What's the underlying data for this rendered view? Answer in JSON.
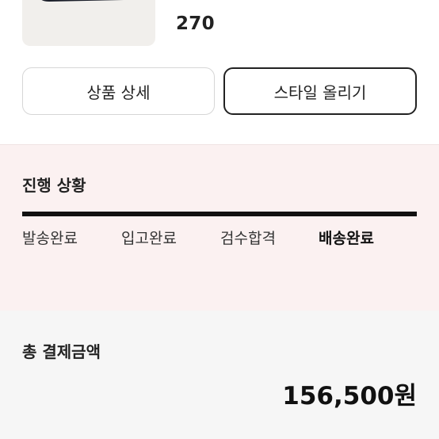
{
  "product": {
    "size": "270"
  },
  "actions": {
    "detail_label": "상품 상세",
    "style_label": "스타일 올리기"
  },
  "progress": {
    "title": "진행 상황",
    "steps": [
      "발송완료",
      "입고완료",
      "검수합격",
      "배송완료"
    ],
    "current_step": "배송완료",
    "completion": 1.0
  },
  "payment": {
    "title": "총 결제금액",
    "amount": "156,500원"
  },
  "colors": {
    "progress_fill": "#111111",
    "progress_bg": "#fbf1f1",
    "payment_bg": "#f6f6f6"
  },
  "icons": {
    "product": "sneaker-image"
  }
}
